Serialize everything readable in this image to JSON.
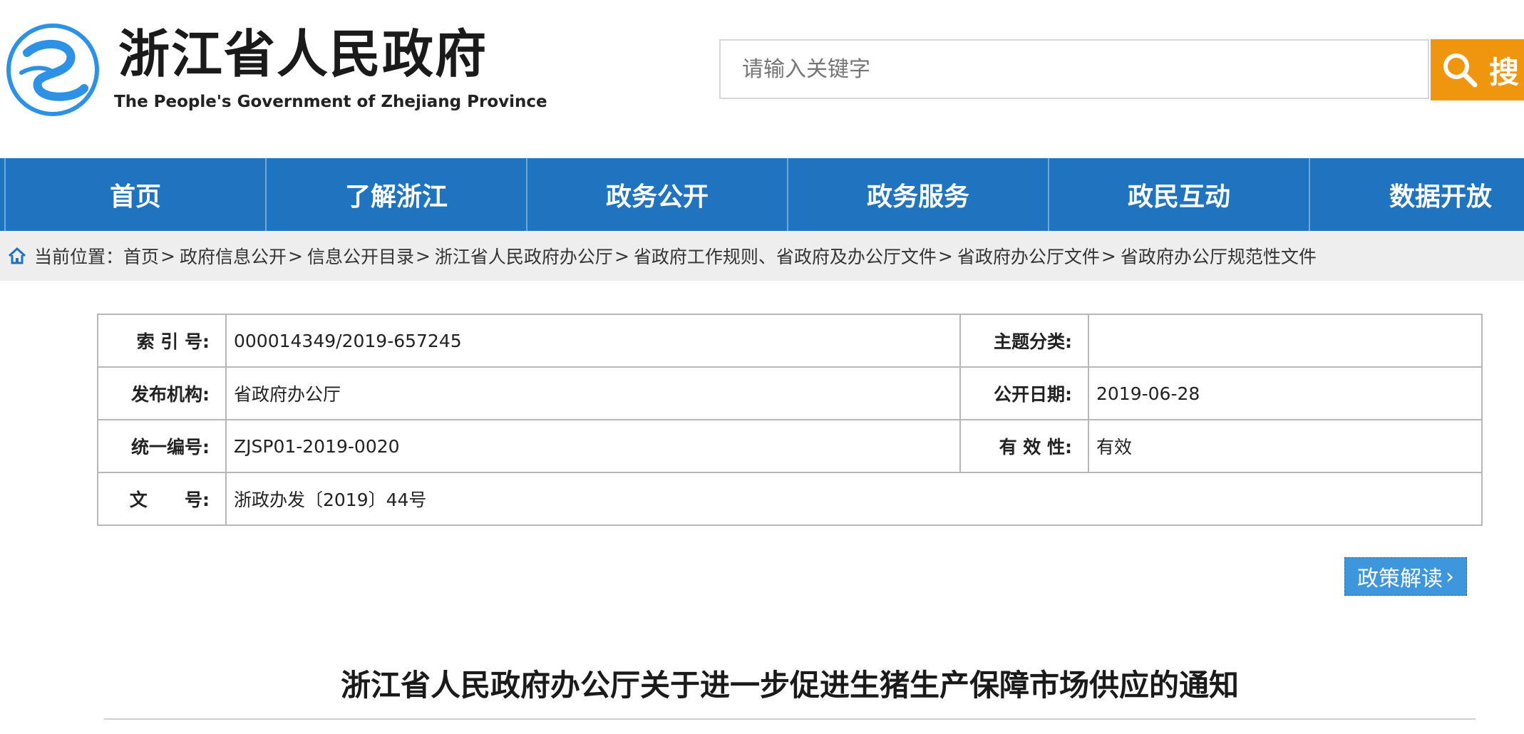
{
  "header": {
    "logo_cn": "浙江省人民政府",
    "logo_en": "The People's Government of Zhejiang Province",
    "search_placeholder": "请输入关键字",
    "search_button": "搜"
  },
  "nav": {
    "items": [
      "首页",
      "了解浙江",
      "政务公开",
      "政务服务",
      "政民互动",
      "数据开放"
    ]
  },
  "breadcrumb": {
    "prefix": "当前位置：",
    "items": [
      "首页",
      "政府信息公开",
      "信息公开目录",
      "浙江省人民政府办公厅",
      "省政府工作规则、省政府及办公厅文件",
      "省政府办公厅文件",
      "省政府办公厅规范性文件"
    ],
    "separator": ">"
  },
  "info": {
    "index_label": "索 引 号:",
    "index_value": "000014349/2019-657245",
    "topic_label": "主题分类:",
    "topic_value": "",
    "publisher_label": "发布机构:",
    "publisher_value": "省政府办公厅",
    "date_label": "公开日期:",
    "date_value": "2019-06-28",
    "code_label": "统一编号:",
    "code_value": "ZJSP01-2019-0020",
    "validity_label": "有 效 性:",
    "validity_value": "有效",
    "docno_label": "文      号:",
    "docno_value": "浙政办发〔2019〕44号"
  },
  "policy_button": "政策解读",
  "document": {
    "title": "浙江省人民政府办公厅关于进一步促进生猪生产保障市场供应的通知"
  },
  "colors": {
    "nav_bg": "#1f73bf",
    "search_btn": "#f0960e",
    "policy_btn": "#3e97dd",
    "breadcrumb_bg": "#eeeeee"
  }
}
